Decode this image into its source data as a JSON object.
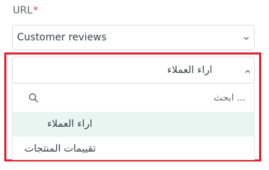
{
  "url_field": {
    "label": "URL",
    "required_mark": "*"
  },
  "language_select": {
    "value": "Customer reviews",
    "icon": "chevron-down-icon"
  },
  "reviews_select": {
    "value": "اراء العملاء",
    "icon": "chevron-up-icon",
    "dropdown": {
      "search_placeholder": "... ابحث",
      "search_icon": "search-icon",
      "options": [
        {
          "label": "اراء العملاء",
          "selected": true
        },
        {
          "label": "تقييمات المنتجات",
          "selected": false
        }
      ]
    }
  },
  "colors": {
    "focus_outline": "#e0232f",
    "selected_option_bg": "#e7f6f1",
    "required": "#e53935"
  }
}
